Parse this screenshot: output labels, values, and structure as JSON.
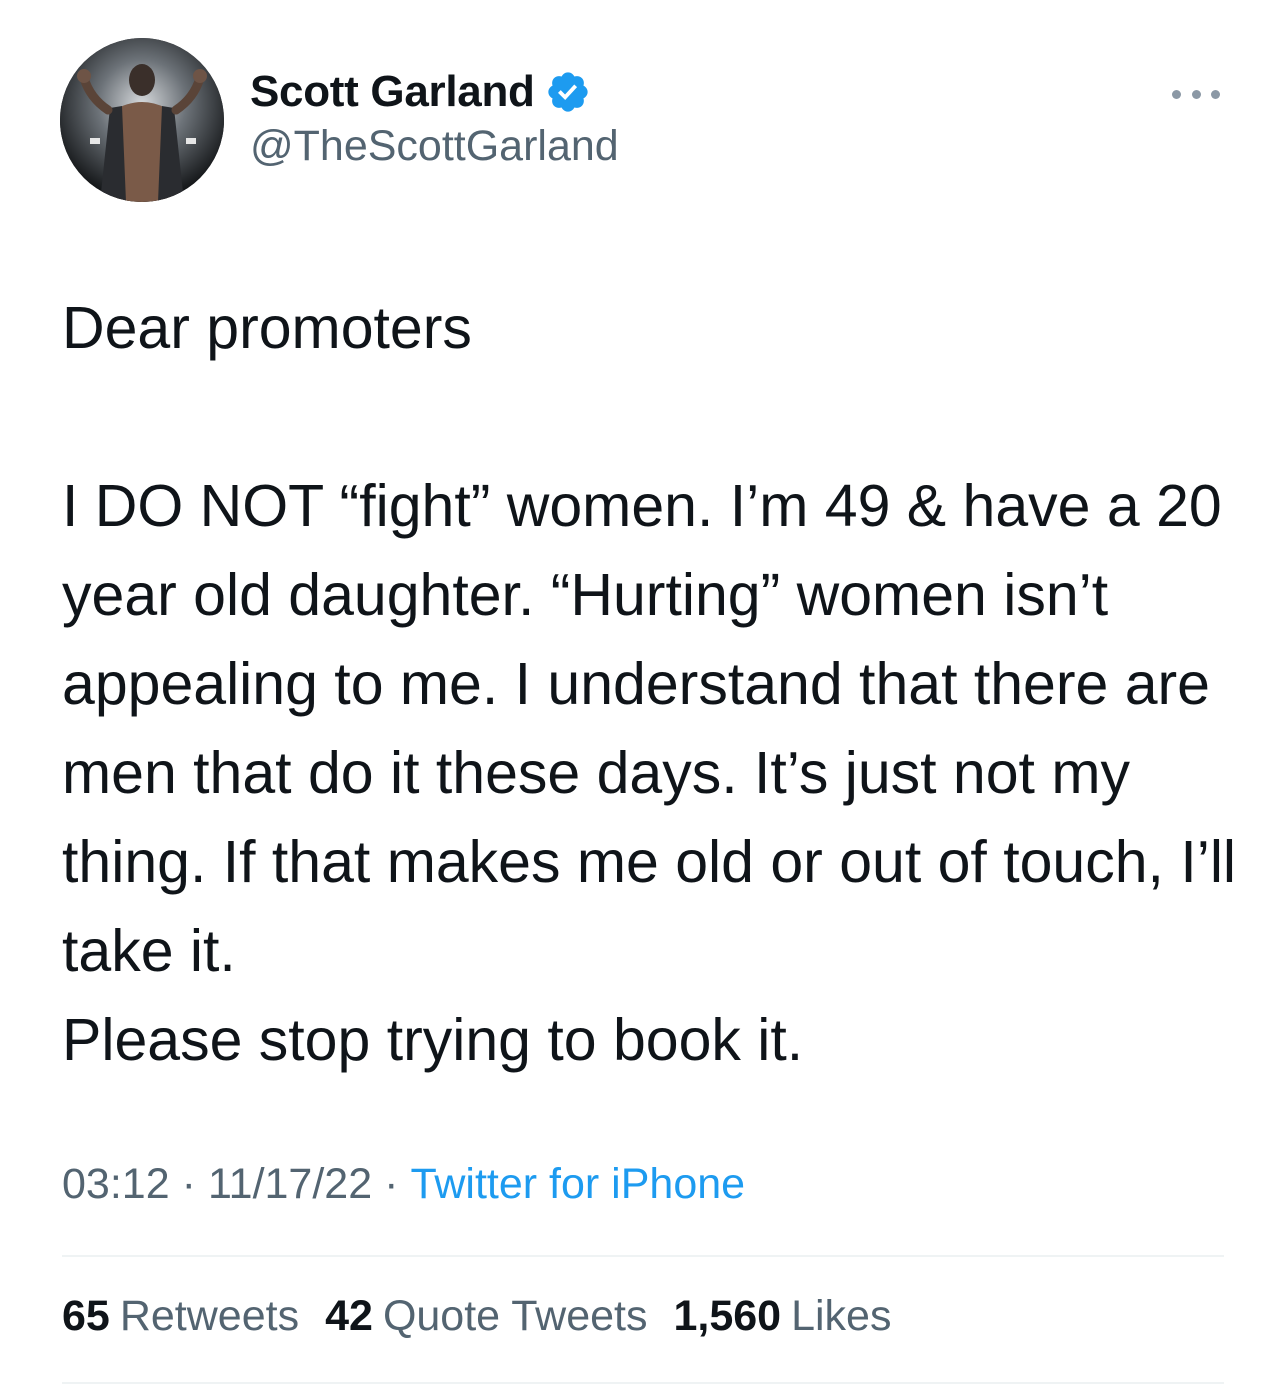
{
  "author": {
    "display_name": "Scott Garland",
    "handle": "@TheScottGarland",
    "verified": true,
    "avatar_icon": "profile-photo"
  },
  "colors": {
    "verified_badge": "#1d9bf0",
    "link": "#1d9bf0",
    "muted_text": "#536471",
    "primary_text": "#0f1419"
  },
  "tweet": {
    "text": "Dear promoters\n\nI DO NOT “fight” women. I’m 49 & have a 20 year old daughter. “Hurting” women isn’t appealing to me. I understand that there are men that do it these days. It’s just not my thing. If that makes me old or out of touch, I’ll take it.\nPlease stop trying to book it."
  },
  "meta": {
    "time": "03:12",
    "separator": "·",
    "date": "11/17/22",
    "source": "Twitter for iPhone"
  },
  "stats": {
    "retweets": {
      "count": "65",
      "label": "Retweets"
    },
    "quote_tweets": {
      "count": "42",
      "label": "Quote Tweets"
    },
    "likes": {
      "count": "1,560",
      "label": "Likes"
    }
  }
}
